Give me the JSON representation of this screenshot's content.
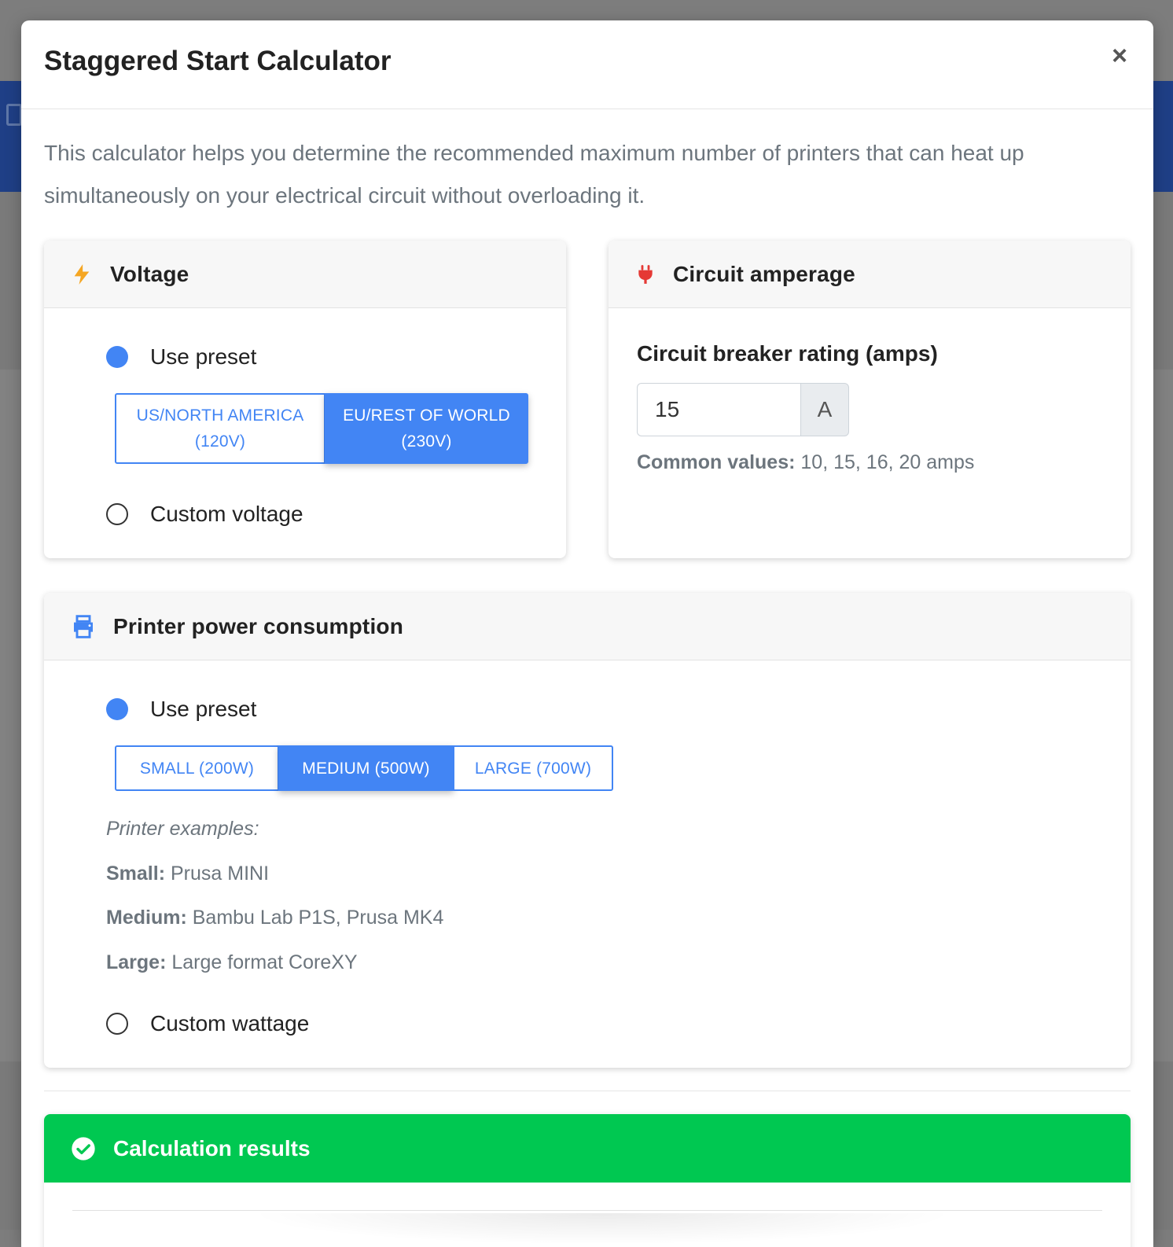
{
  "modal": {
    "title": "Staggered Start Calculator",
    "close_symbol": "×",
    "intro": "This calculator helps you determine the recommended maximum number of printers that can heat up simultaneously on your electrical circuit without overloading it."
  },
  "voltage": {
    "icon": "bolt-icon",
    "title": "Voltage",
    "preset_label": "Use preset",
    "preset_selected": true,
    "presets": [
      {
        "label": "US/NORTH AMERICA (120V)",
        "active": false
      },
      {
        "label": "EU/REST OF WORLD (230V)",
        "active": true
      }
    ],
    "custom_label": "Custom voltage"
  },
  "amperage": {
    "icon": "plug-icon",
    "title": "Circuit amperage",
    "field_label": "Circuit breaker rating (amps)",
    "value": "15",
    "unit": "A",
    "hint_label": "Common values:",
    "hint_values": "10, 15, 16, 20 amps"
  },
  "power": {
    "icon": "printer-icon",
    "title": "Printer power consumption",
    "preset_label": "Use preset",
    "preset_selected": true,
    "presets": [
      {
        "label": "SMALL (200W)",
        "active": false
      },
      {
        "label": "MEDIUM (500W)",
        "active": true
      },
      {
        "label": "LARGE (700W)",
        "active": false
      }
    ],
    "examples_heading": "Printer examples:",
    "examples": [
      {
        "size": "Small:",
        "models": "Prusa MINI"
      },
      {
        "size": "Medium:",
        "models": "Bambu Lab P1S, Prusa MK4"
      },
      {
        "size": "Large:",
        "models": "Large format CoreXY"
      }
    ],
    "custom_label": "Custom wattage"
  },
  "results": {
    "icon": "check-circle-icon",
    "title": "Calculation results"
  },
  "colors": {
    "primary": "#4285f4",
    "success": "#00c851",
    "bolt": "#f5a623",
    "plug": "#e53935"
  }
}
